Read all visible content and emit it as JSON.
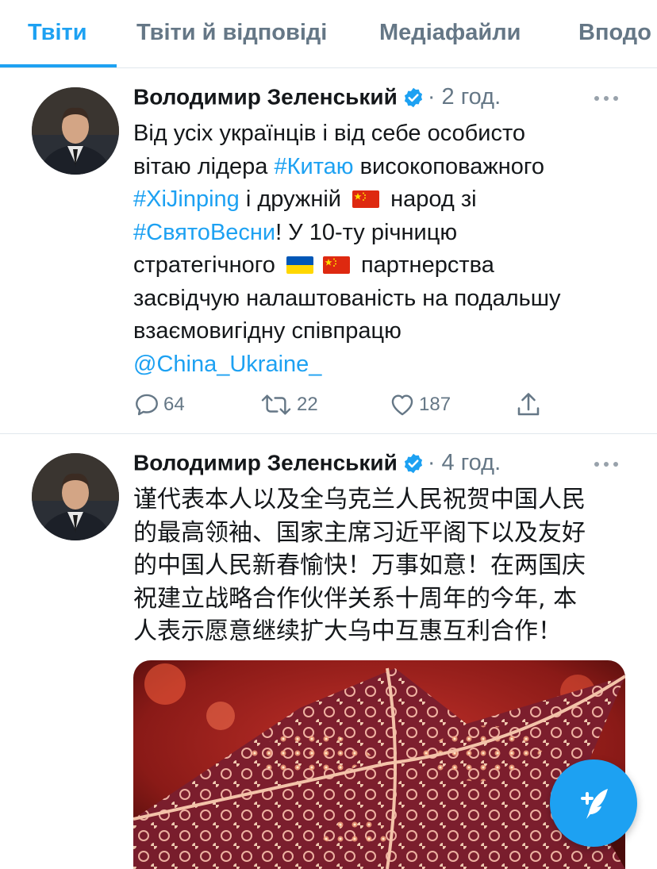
{
  "tabs": [
    {
      "label": "Твіти",
      "active": true
    },
    {
      "label": "Твіти й відповіді",
      "active": false
    },
    {
      "label": "Медіафайли",
      "active": false
    },
    {
      "label": "Вподо",
      "active": false
    }
  ],
  "colors": {
    "accent": "#1da1f2",
    "secondary_text": "#657786",
    "divider": "#e1e8ed"
  },
  "tweets": [
    {
      "author": "Володимир Зеленський",
      "verified": true,
      "time": "· 2 год.",
      "text": {
        "l1": "Від усіх українців і від себе особисто",
        "l2a": "вітаю лідера ",
        "l2b": "#Китаю",
        "l2c": " високоповажного",
        "l3a": "#XiJinping",
        "l3b": " і дружній ",
        "l3c": " народ зі",
        "l4a": "#СвятоВесни",
        "l4b": "! У 10-ту річницю",
        "l5a": "стратегічного ",
        "l5b": " партнерства",
        "l6": "засвідчую налаштованість на подальшу",
        "l7": "взаємовигідну співпрацю",
        "l8": "@China_Ukraine_"
      },
      "counts": {
        "replies": "64",
        "retweets": "22",
        "likes": "187"
      }
    },
    {
      "author": "Володимир Зеленський",
      "verified": true,
      "time": "· 4 год.",
      "text": {
        "l1": "谨代表本人以及全乌克兰人民祝贺中国人民",
        "l2": "的最高领袖、国家主席习近平阁下以及友好",
        "l3": "的中国人民新春愉快！万事如意！在两国庆",
        "l4": "祝建立战略合作伙伴关系十周年的今年, 本",
        "l5": "人表示愿意继续扩大乌中互惠互利合作！"
      }
    }
  ],
  "icons": [
    "verified-icon",
    "more-icon",
    "reply-icon",
    "retweet-icon",
    "like-icon",
    "share-icon",
    "compose-icon",
    "flag-china-icon",
    "flag-ukraine-icon"
  ]
}
